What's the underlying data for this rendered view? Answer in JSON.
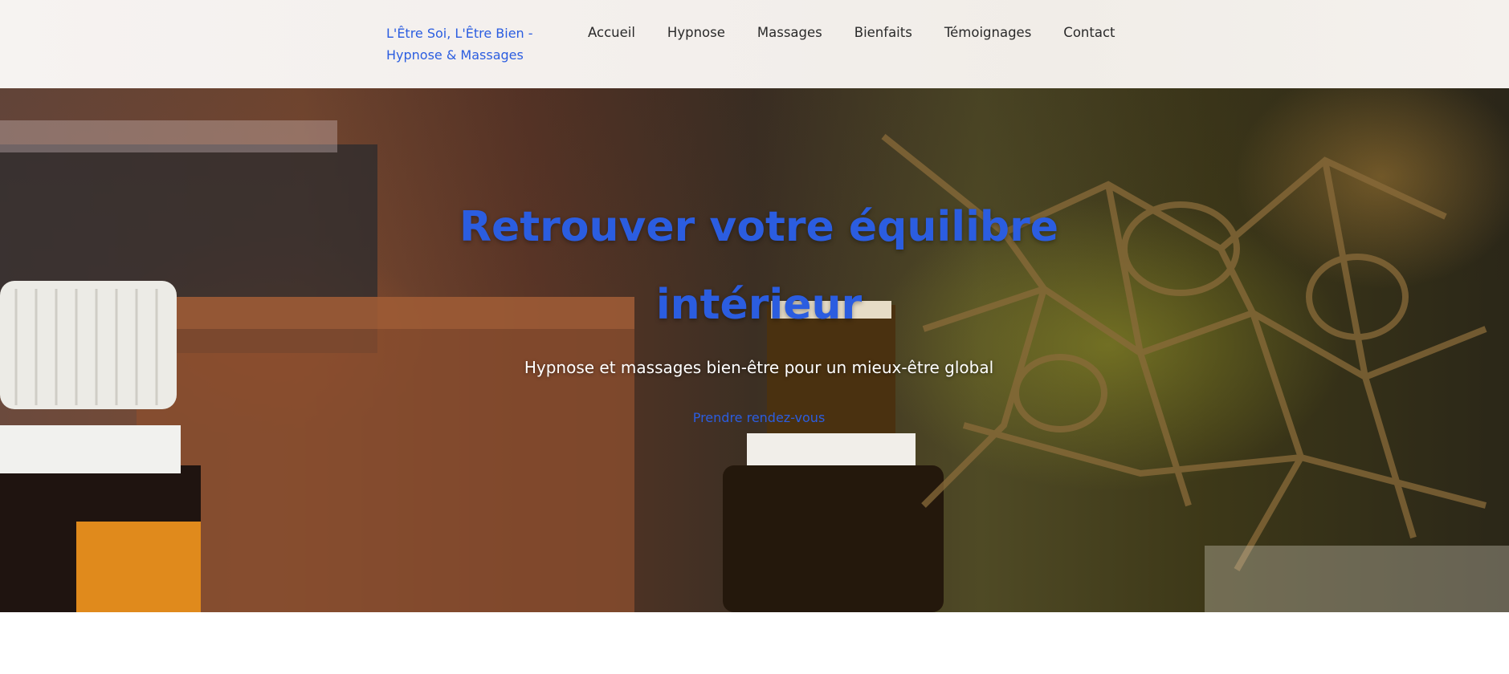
{
  "header": {
    "brand_line1": "L'Être Soi, L'Être Bien -",
    "brand_line2": "Hypnose & Massages",
    "nav": [
      {
        "label": "Accueil"
      },
      {
        "label": "Hypnose"
      },
      {
        "label": "Massages"
      },
      {
        "label": "Bienfaits"
      },
      {
        "label": "Témoignages"
      },
      {
        "label": "Contact"
      }
    ]
  },
  "hero": {
    "title": "Retrouver votre équilibre intérieur",
    "subtitle": "Hypnose et massages bien-être pour un mieux-être global",
    "cta": "Prendre rendez-vous",
    "background_image": "essential-oil-bottles-photo"
  },
  "colors": {
    "accent": "#2b5de0",
    "header_bg": "#f4f1ed",
    "text_dark": "#2a2a2a"
  }
}
